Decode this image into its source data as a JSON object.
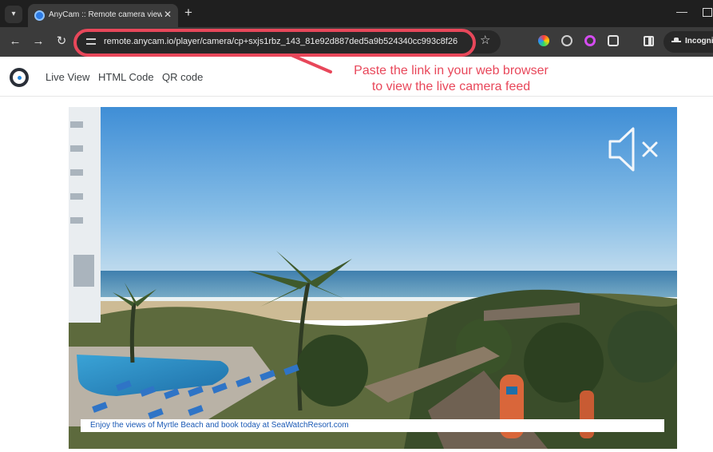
{
  "browser": {
    "tab_title": "AnyCam :: Remote camera view",
    "tab_close": "✕",
    "new_tab": "+",
    "url": "remote.anycam.io/player/camera/cp+sxjs1rbz_143_81e92d887ded5a9b524340cc993c8f26",
    "incognito_label": "Incognito",
    "minimize": "—"
  },
  "annotation": {
    "line1": "Paste the link in your web browser",
    "line2": "to view the live camera feed",
    "color": "#e8475a"
  },
  "site_nav": {
    "items": [
      "Live View",
      "HTML Code",
      "QR code"
    ]
  },
  "player": {
    "muted": true,
    "caption": "Enjoy the views of Myrtle Beach and book today at SeaWatchResort.com"
  },
  "icons": {
    "tab_list": "chevron-down-icon",
    "back": "arrow-left-icon",
    "forward": "arrow-right-icon",
    "reload": "reload-icon",
    "bookmark": "star-icon",
    "mute": "speaker-muted-icon"
  }
}
